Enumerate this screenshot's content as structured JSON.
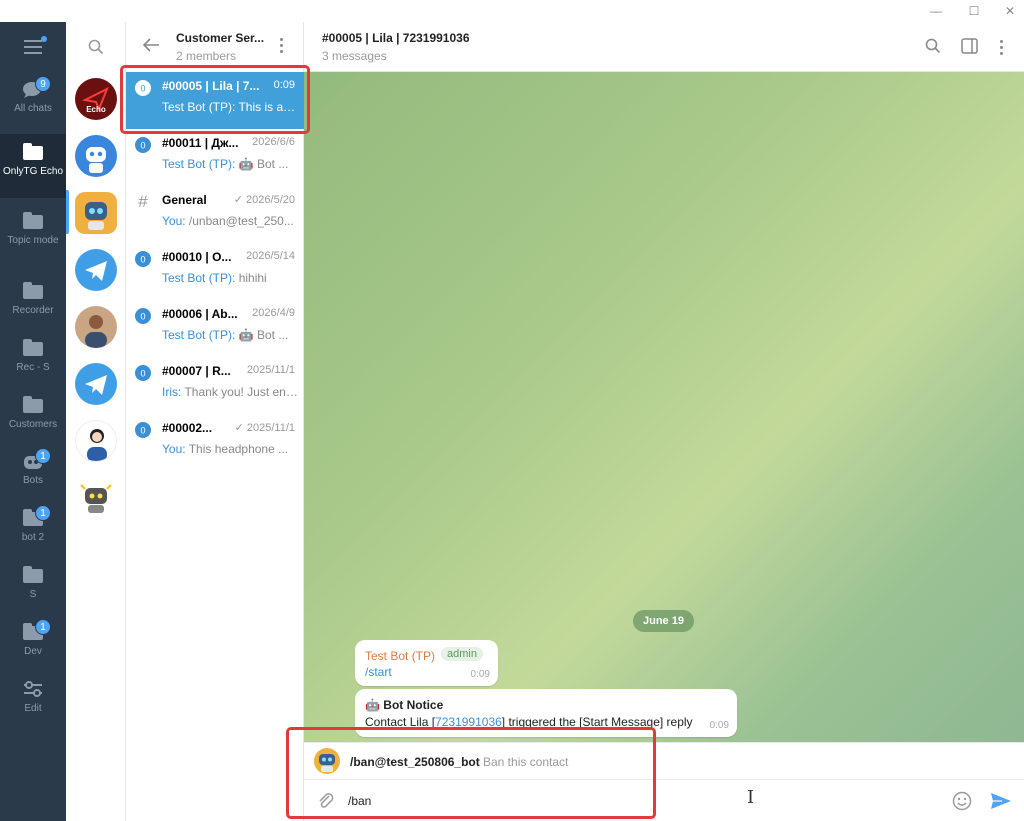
{
  "folders": [
    {
      "label": "All chats",
      "icon": "chat-bubbles-icon",
      "badge": "9"
    },
    {
      "label": "OnlyTG Echo",
      "icon": "folder-icon",
      "badge": ""
    },
    {
      "label": "Topic mode",
      "icon": "folder-icon",
      "badge": ""
    },
    {
      "label": "Recorder",
      "icon": "folder-icon",
      "badge": ""
    },
    {
      "label": "Rec - S",
      "icon": "folder-icon",
      "badge": ""
    },
    {
      "label": "Customers",
      "icon": "folder-icon",
      "badge": ""
    },
    {
      "label": "Bots",
      "icon": "bot-icon",
      "badge": "1"
    },
    {
      "label": "bot 2",
      "icon": "folder-icon",
      "badge": "1"
    },
    {
      "label": "S",
      "icon": "folder-icon",
      "badge": ""
    },
    {
      "label": "Dev",
      "icon": "folder-icon",
      "badge": "1"
    },
    {
      "label": "Edit",
      "icon": "sliders-icon",
      "badge": ""
    }
  ],
  "avatars": [
    {
      "label": "Echo"
    }
  ],
  "list_header": {
    "title": "Customer Ser...",
    "subtitle": "2 members"
  },
  "chats": [
    {
      "title": "#00005 | Lila | 7...",
      "time": "0:09",
      "sender": "",
      "preview": "Test Bot (TP): This is a s...",
      "badge": "0",
      "selected": true
    },
    {
      "title": "#00011 | Дж...",
      "time": "2026/6/6",
      "sender": "Test Bot (TP):",
      "preview": " 🤖 Bot ...",
      "badge": "0"
    },
    {
      "title": "General",
      "time": "✓ 2026/5/20",
      "sender": "You:",
      "preview": " /unban@test_250...",
      "badge": "#"
    },
    {
      "title": "#00010 | О...",
      "time": "2026/5/14",
      "sender": "Test Bot (TP):",
      "preview": " hihihi",
      "badge": "0"
    },
    {
      "title": "#00006 | Ab...",
      "time": "2026/4/9",
      "sender": "Test Bot (TP):",
      "preview": " 🤖 Bot ...",
      "badge": "0"
    },
    {
      "title": "#00007 | R...",
      "time": "2025/11/1",
      "sender": "Iris:",
      "preview": " Thank you! Just enj...",
      "badge": "0"
    },
    {
      "title": "#00002...",
      "time": "✓ 2025/11/1",
      "sender": "You:",
      "preview": " This headphone ...",
      "badge": "0"
    }
  ],
  "chat_header": {
    "title": "#00005 | Lila | 7231991036",
    "subtitle": "3 messages"
  },
  "date_pill": "June 19",
  "messages": [
    {
      "sender": "Test Bot (TP)",
      "role": "admin",
      "text": "/start",
      "time": "0:09"
    },
    {
      "title": "🤖 Bot Notice",
      "text_before": "Contact Lila [",
      "link": "7231991036",
      "text_after": "] triggered the [Start Message] reply",
      "time": "0:09"
    }
  ],
  "command": {
    "name": "/ban@test_250806_bot",
    "description": "Ban this contact"
  },
  "input": {
    "value": "/ban"
  },
  "colors": {
    "accent": "#4ea4f6",
    "sidebar": "#2b3a4b",
    "selected_row": "#419fd9",
    "highlight": "#e03a3a",
    "bot_name": "#e07b39"
  }
}
